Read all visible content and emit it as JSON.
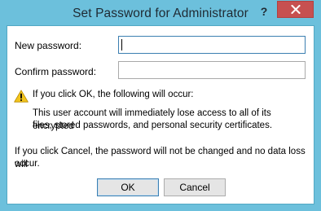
{
  "window": {
    "title": "Set Password for Administrator",
    "help_label": "?"
  },
  "form": {
    "new_password_label": "New password:",
    "new_password_value": "",
    "confirm_password_label": "Confirm password:",
    "confirm_password_value": ""
  },
  "warning": {
    "heading": "If you click OK, the following will occur:",
    "line1": "This user account will immediately lose access to all of its encrypted",
    "line2": "files, stored passwords, and personal security certificates."
  },
  "cancel_note": {
    "line1": "If you click Cancel, the password will not be changed and no data loss will",
    "line2": "occur."
  },
  "buttons": {
    "ok_label": "OK",
    "cancel_label": "Cancel"
  },
  "colors": {
    "frame": "#6cc0dc",
    "close_button": "#c75050",
    "warning_icon": "#f2c41c"
  },
  "icons": {
    "close": "close-icon",
    "warning": "warning-icon"
  }
}
